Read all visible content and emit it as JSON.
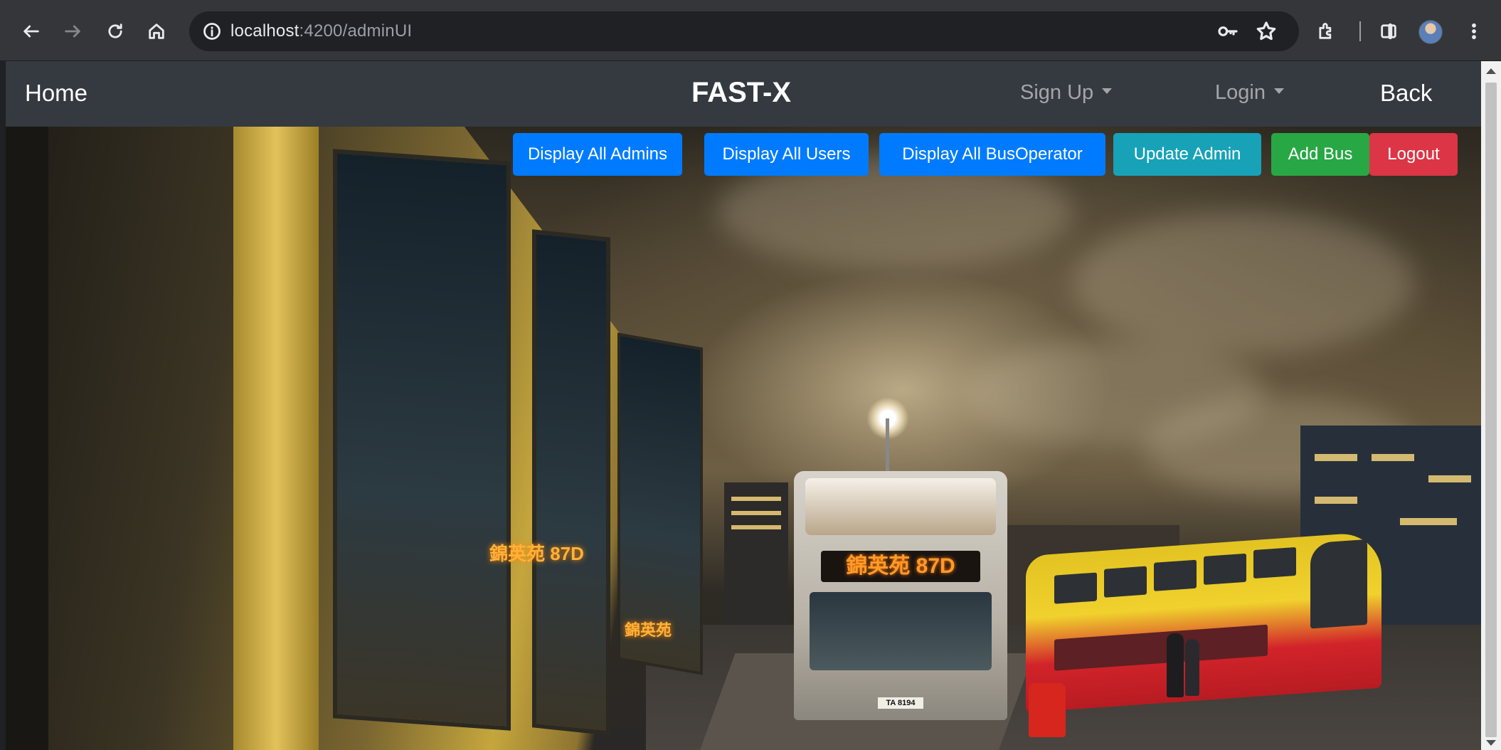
{
  "browser": {
    "url_host": "localhost",
    "url_rest": ":4200/adminUI"
  },
  "navbar": {
    "home": "Home",
    "brand": "FAST-X",
    "signup": "Sign Up",
    "login": "Login",
    "back": "Back"
  },
  "actions": {
    "display_admins": "Display All Admins",
    "display_users": "Display All Users",
    "display_operators": "Display All BusOperator",
    "update_admin": "Update Admin",
    "add_bus": "Add Bus",
    "logout": "Logout"
  },
  "colors": {
    "primary": "#007bff",
    "info": "#17a2b8",
    "success": "#28a745",
    "danger": "#dc3545",
    "navbar": "#343a40"
  },
  "scene": {
    "bus_display": "錦英苑 87D",
    "plate": "TA 8194"
  }
}
